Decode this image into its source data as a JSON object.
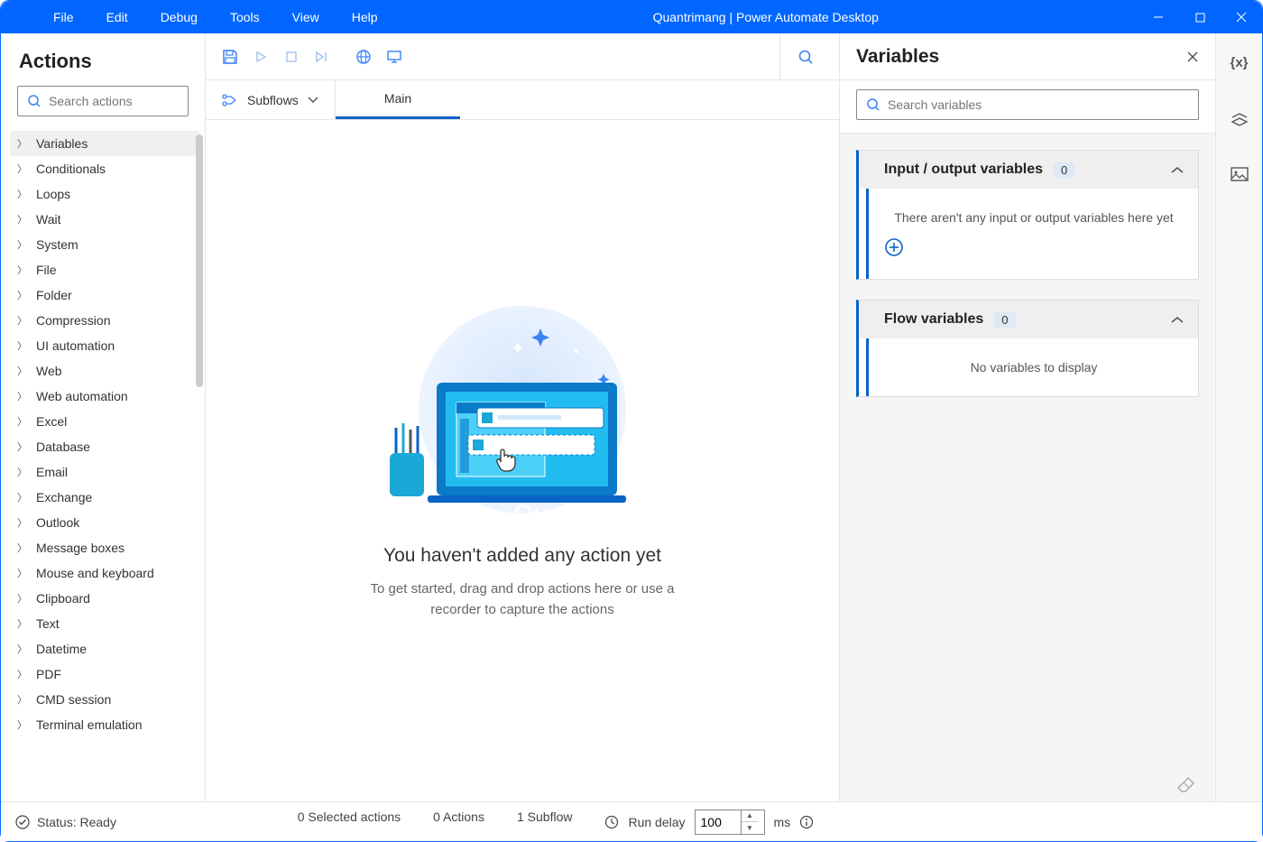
{
  "titlebar": {
    "menu": [
      "File",
      "Edit",
      "Debug",
      "Tools",
      "View",
      "Help"
    ],
    "title": "Quantrimang | Power Automate Desktop"
  },
  "actions_panel": {
    "title": "Actions",
    "search_placeholder": "Search actions",
    "categories": [
      "Variables",
      "Conditionals",
      "Loops",
      "Wait",
      "System",
      "File",
      "Folder",
      "Compression",
      "UI automation",
      "Web",
      "Web automation",
      "Excel",
      "Database",
      "Email",
      "Exchange",
      "Outlook",
      "Message boxes",
      "Mouse and keyboard",
      "Clipboard",
      "Text",
      "Datetime",
      "PDF",
      "CMD session",
      "Terminal emulation"
    ],
    "selected_index": 0
  },
  "designer": {
    "subflows_label": "Subflows",
    "tabs": [
      {
        "label": "Main"
      }
    ],
    "empty_title": "You haven't added any action yet",
    "empty_sub": "To get started, drag and drop actions here or use a recorder to capture the actions",
    "watermark": "Quantrimang.com"
  },
  "variables_panel": {
    "title": "Variables",
    "search_placeholder": "Search variables",
    "io_section": {
      "title": "Input / output variables",
      "count": "0",
      "empty_text": "There aren't any input or output variables here yet"
    },
    "flow_section": {
      "title": "Flow variables",
      "count": "0",
      "empty_text": "No variables to display"
    }
  },
  "statusbar": {
    "status": "Status: Ready",
    "selected": "0 Selected actions",
    "actions": "0 Actions",
    "subflows": "1 Subflow",
    "run_delay_label": "Run delay",
    "run_delay_value": "100",
    "run_delay_unit": "ms"
  }
}
